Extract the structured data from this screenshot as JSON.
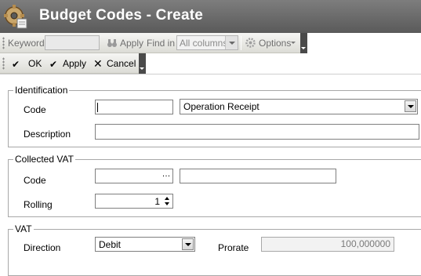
{
  "window": {
    "title": "Budget Codes - Create",
    "title_color": "#ffffff"
  },
  "search_toolbar": {
    "keyword_label": "Keyword",
    "keyword_value": "",
    "apply_label": "Apply",
    "find_in_label": "Find in",
    "find_in_value": "All columns",
    "options_label": "Options"
  },
  "action_toolbar": {
    "ok_label": "OK",
    "apply_label": "Apply",
    "cancel_label": "Cancel"
  },
  "identification": {
    "legend": "Identification",
    "code_label": "Code",
    "code_value": "",
    "type_value": "Operation Receipt",
    "description_label": "Description",
    "description_value": ""
  },
  "collected_vat": {
    "legend": "Collected VAT",
    "code_label": "Code",
    "code_value": "",
    "code_desc_value": "",
    "rolling_label": "Rolling",
    "rolling_value": "1"
  },
  "vat": {
    "legend": "VAT",
    "direction_label": "Direction",
    "direction_value": "Debit",
    "prorate_label": "Prorate",
    "prorate_value": "100,000000"
  }
}
